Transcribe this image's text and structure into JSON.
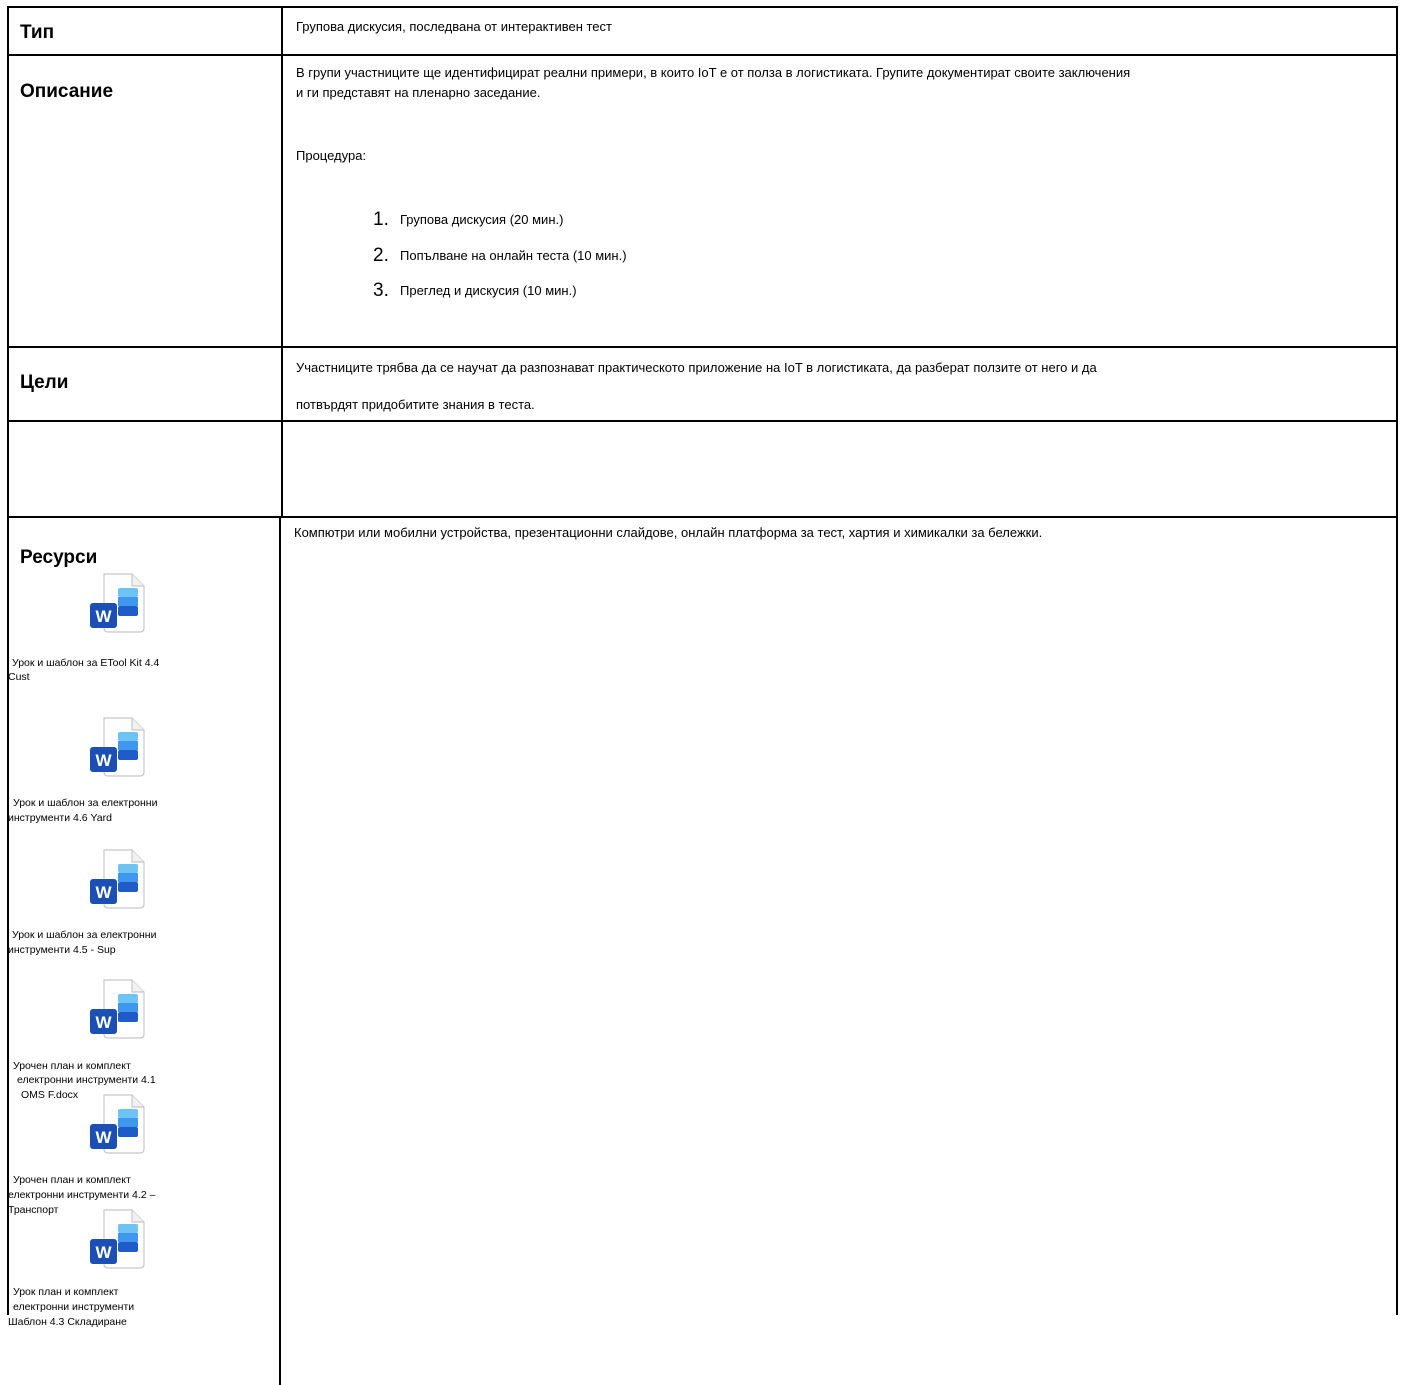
{
  "rows": {
    "type": {
      "label": "Тип",
      "value": "Групова дискусия, последвана от интерактивен тест"
    },
    "description": {
      "label": "Описание",
      "text_line1": "В групи участниците ще идентифицират реални примери, в които IoT е от полза в логистиката. Групите документират своите заключения",
      "text_line2": "и ги представят на пленарно заседание.",
      "procedure_label": "Процедура:",
      "steps": [
        {
          "num": "1.",
          "text": "Групова дискусия (20 мин.)"
        },
        {
          "num": "2.",
          "text": "Попълване на онлайн теста (10 мин.)"
        },
        {
          "num": "3.",
          "text": "Преглед и дискусия (10 мин.)"
        }
      ]
    },
    "goals": {
      "label": "Цели",
      "text_line1": "Участниците трябва да се научат да разпознават практическото приложение на IoT в логистиката, да разберат ползите от него и да",
      "text_line2": "потвърдят придобитите знания в теста."
    },
    "resources": {
      "label": "Ресурси",
      "text": "Компютри или мобилни устройства, презентационни слайдове, онлайн платформа за тест, хартия и химикалки за бележки.",
      "files": [
        {
          "lines": [
            "Урок и шаблон за ETool Kit 4.4",
            "Cust"
          ],
          "icon": "word-document-icon"
        },
        {
          "lines": [
            "Урок и шаблон за електронни",
            "инструменти 4.6 Yard"
          ],
          "icon": "word-document-icon"
        },
        {
          "lines": [
            "Урок и шаблон за електронни",
            "инструменти 4.5 - Sup"
          ],
          "icon": "word-document-icon"
        },
        {
          "lines": [
            "Урочен план и комплект",
            "електронни инструменти 4.1",
            "OMS F.docx"
          ],
          "icon": "word-document-icon"
        },
        {
          "lines": [
            "Урочен план и комплект",
            "електронни инструменти 4.2 –",
            "Транспорт"
          ],
          "icon": "word-document-icon"
        },
        {
          "lines": [
            "Урок план и комплект",
            "електронни инструменти",
            "Шаблон 4.3 Складиране"
          ],
          "icon": "word-document-icon"
        }
      ]
    }
  },
  "colors": {
    "word_dark": "#1b4fb4",
    "word_mid": "#2f7ee6",
    "word_light": "#6ec3f5"
  }
}
